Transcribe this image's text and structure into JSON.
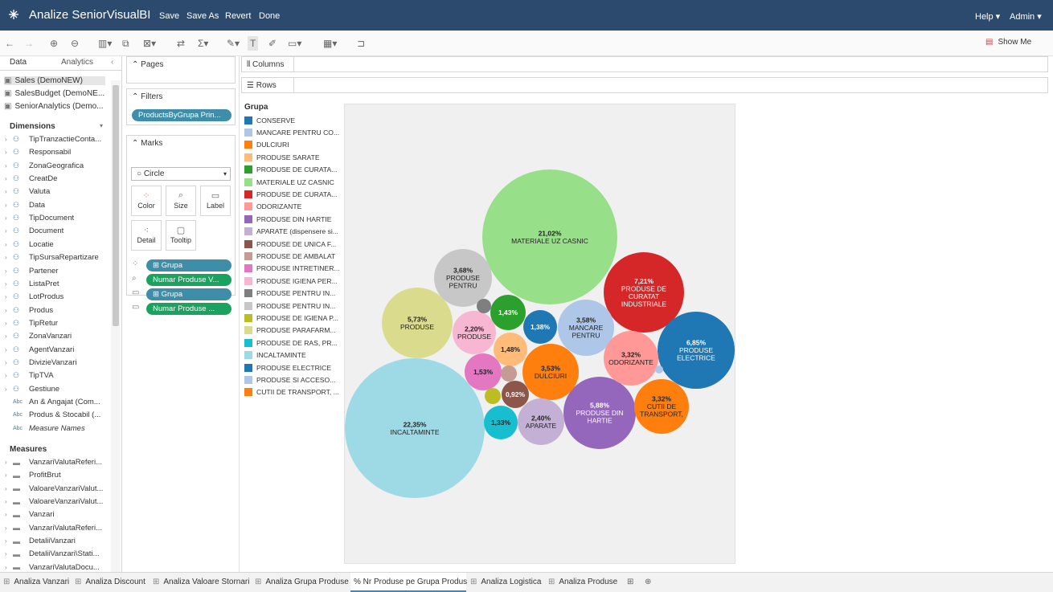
{
  "app": {
    "title": "Analize SeniorVisualBI",
    "save": "Save",
    "save_as": "Save As",
    "revert": "Revert",
    "done": "Done",
    "help": "Help ▾",
    "user": "Admin ▾"
  },
  "toolbar": {
    "show_me": "Show Me"
  },
  "left": {
    "tab_data": "Data",
    "tab_analytics": "Analytics",
    "datasources": [
      "Sales (DemoNEW)",
      "SalesBudget (DemoNE...",
      "SeniorAnalytics (Demo..."
    ],
    "dimensions_label": "Dimensions",
    "dimensions": [
      "TipTranzactieConta...",
      "Responsabil",
      "ZonaGeografica",
      "CreatDe",
      "Valuta",
      "Data",
      "TipDocument",
      "Document",
      "Locatie",
      "TipSursaRepartizare",
      "Partener",
      "ListaPret",
      "LotProdus",
      "Produs",
      "TipRetur",
      "ZonaVanzari",
      "AgentVanzari",
      "DivizieVanzari",
      "TipTVA",
      "Gestiune"
    ],
    "abc_fields": [
      "An & Angajat (Com...",
      "Produs & Stocabil (...",
      "Measure Names"
    ],
    "measures_label": "Measures",
    "measures": [
      "VanzariValutaReferi...",
      "ProfitBrut",
      "ValoareVanzariValut...",
      "ValoareVanzariValut...",
      "Vanzari",
      "VanzariValutaReferi...",
      "DetaliiVanzari",
      "DetaliiVanzari\\Stati...",
      "VanzariValutaDocu..."
    ]
  },
  "shelves": {
    "pages": "Pages",
    "filters": "Filters",
    "filter_pill": "ProductsByGrupa Prin...",
    "marks": "Marks",
    "mark_type": "Circle",
    "mark_buttons": [
      "Color",
      "Size",
      "Label",
      "Detail",
      "Tooltip"
    ],
    "mark_pills": [
      "⊞ Grupa",
      "Numar Produse V...",
      "⊞ Grupa",
      "Numar Produse ..."
    ],
    "columns": "Columns",
    "rows": "Rows"
  },
  "chart_data": {
    "type": "bubble",
    "legend_title": "Grupa",
    "legend": [
      {
        "name": "CONSERVE",
        "color": "#1f77b4"
      },
      {
        "name": "MANCARE PENTRU CO...",
        "color": "#aec7e8"
      },
      {
        "name": "DULCIURI",
        "color": "#ff7f0e"
      },
      {
        "name": "PRODUSE SARATE",
        "color": "#ffbb78"
      },
      {
        "name": "PRODUSE DE CURATA...",
        "color": "#2ca02c"
      },
      {
        "name": "MATERIALE UZ CASNIC",
        "color": "#98df8a"
      },
      {
        "name": "PRODUSE DE CURATA...",
        "color": "#d62728"
      },
      {
        "name": "ODORIZANTE",
        "color": "#ff9896"
      },
      {
        "name": "PRODUSE DIN HARTIE",
        "color": "#9467bd"
      },
      {
        "name": "APARATE (dispensere si...",
        "color": "#c5b0d5"
      },
      {
        "name": "PRODUSE DE UNICA F...",
        "color": "#8c564b"
      },
      {
        "name": "PRODUSE DE AMBALAT",
        "color": "#c49c94"
      },
      {
        "name": "PRODUSE INTRETINER...",
        "color": "#e377c2"
      },
      {
        "name": "PRODUSE IGIENA PER...",
        "color": "#f7b6d2"
      },
      {
        "name": "PRODUSE PENTRU IN...",
        "color": "#7f7f7f"
      },
      {
        "name": "PRODUSE PENTRU IN...",
        "color": "#c7c7c7"
      },
      {
        "name": "PRODUSE DE IGIENA P...",
        "color": "#bcbd22"
      },
      {
        "name": "PRODUSE PARAFARM...",
        "color": "#dbdb8d"
      },
      {
        "name": "PRODUSE DE RAS, PR...",
        "color": "#17becf"
      },
      {
        "name": "INCALTAMINTE",
        "color": "#9edae5"
      },
      {
        "name": "PRODUSE ELECTRICE",
        "color": "#1f77b4"
      },
      {
        "name": "PRODUSE SI ACCESO...",
        "color": "#aec7e8"
      },
      {
        "name": "CUTII DE TRANSPORT, ...",
        "color": "#ff7f0e"
      }
    ],
    "bubbles": [
      {
        "pct": "22,35%",
        "label": [
          "INCALTAMINTE"
        ],
        "color": "#9edae5",
        "dark": false
      },
      {
        "pct": "21,02%",
        "label": [
          "MATERIALE UZ CASNIC"
        ],
        "color": "#98df8a",
        "dark": false
      },
      {
        "pct": "7,21%",
        "label": [
          "PRODUSE DE",
          "CURATAT",
          "INDUSTRIALE"
        ],
        "color": "#d62728",
        "dark": true
      },
      {
        "pct": "6,85%",
        "label": [
          "PRODUSE",
          "ELECTRICE"
        ],
        "color": "#1f77b4",
        "dark": true
      },
      {
        "pct": "5,88%",
        "label": [
          "PRODUSE DIN",
          "HARTIE"
        ],
        "color": "#9467bd",
        "dark": true
      },
      {
        "pct": "5,73%",
        "label": [
          "PRODUSE"
        ],
        "color": "#dbdb8d",
        "dark": false
      },
      {
        "pct": "3,68%",
        "label": [
          "PRODUSE",
          "PENTRU"
        ],
        "color": "#c7c7c7",
        "dark": false
      },
      {
        "pct": "3,58%",
        "label": [
          "MANCARE",
          "PENTRU"
        ],
        "color": "#aec7e8",
        "dark": false
      },
      {
        "pct": "3,53%",
        "label": [
          "DULCIURI"
        ],
        "color": "#ff7f0e",
        "dark": false
      },
      {
        "pct": "3,32%",
        "label": [
          "ODORIZANTE"
        ],
        "color": "#ff9896",
        "dark": false
      },
      {
        "pct": "3,32%",
        "label": [
          "CUTII DE",
          "TRANSPORT,"
        ],
        "color": "#ff7f0e",
        "dark": false
      },
      {
        "pct": "2,40%",
        "label": [
          "APARATE"
        ],
        "color": "#c5b0d5",
        "dark": false
      },
      {
        "pct": "2,20%",
        "label": [
          "PRODUSE"
        ],
        "color": "#f7b6d2",
        "dark": false
      },
      {
        "pct": "1,53%",
        "label": [],
        "color": "#e377c2",
        "dark": false
      },
      {
        "pct": "1,48%",
        "label": [],
        "color": "#ffbb78",
        "dark": false
      },
      {
        "pct": "1,43%",
        "label": [],
        "color": "#2ca02c",
        "dark": true
      },
      {
        "pct": "1,38%",
        "label": [],
        "color": "#1f77b4",
        "dark": true
      },
      {
        "pct": "1,33%",
        "label": [],
        "color": "#17becf",
        "dark": false
      },
      {
        "pct": "0,92%",
        "label": [],
        "color": "#8c564b",
        "dark": true
      },
      {
        "pct": "",
        "label": [],
        "color": "#c49c94",
        "dark": false
      },
      {
        "pct": "",
        "label": [],
        "color": "#bcbd22",
        "dark": false
      },
      {
        "pct": "",
        "label": [],
        "color": "#7f7f7f",
        "dark": false
      },
      {
        "pct": "",
        "label": [],
        "color": "#aec7e8",
        "dark": false
      }
    ]
  },
  "sheet_tabs": [
    "Analiza Vanzari",
    "Analiza Discount",
    "Analiza Valoare Stornari",
    "Analiza Grupa Produse",
    "% Nr Produse pe Grupa Produs",
    "Analiza Logistica",
    "Analiza Produse"
  ]
}
